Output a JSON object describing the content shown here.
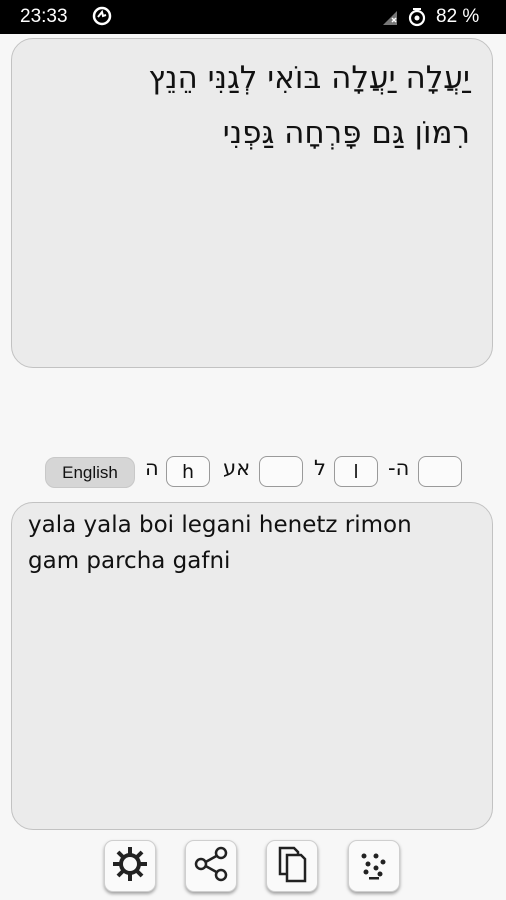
{
  "status_bar": {
    "time": "23:33",
    "battery_percent": "82 %"
  },
  "hebrew_input": {
    "lines": [
      "יַעֲלָה יַעֲלָה בּוֹאִי לְגַנִּי הֵנֵץ",
      "רִמּוֹן גַּם פָּרְחָה גַּפְנִי"
    ]
  },
  "mapping_bar": {
    "english_button": "English",
    "items": [
      {
        "hebrew": "ה",
        "latin": "h"
      },
      {
        "hebrew": "אע",
        "latin": ""
      },
      {
        "hebrew": "ל",
        "latin": "l"
      },
      {
        "hebrew": "ה-",
        "latin": ""
      }
    ]
  },
  "transliteration_output": {
    "lines": [
      "yala yala boi legani henetz rimon",
      "gam parcha gafni"
    ]
  },
  "toolbar": {
    "icons": [
      "settings-icon",
      "share-icon",
      "copy-icon",
      "dots-icon"
    ]
  }
}
